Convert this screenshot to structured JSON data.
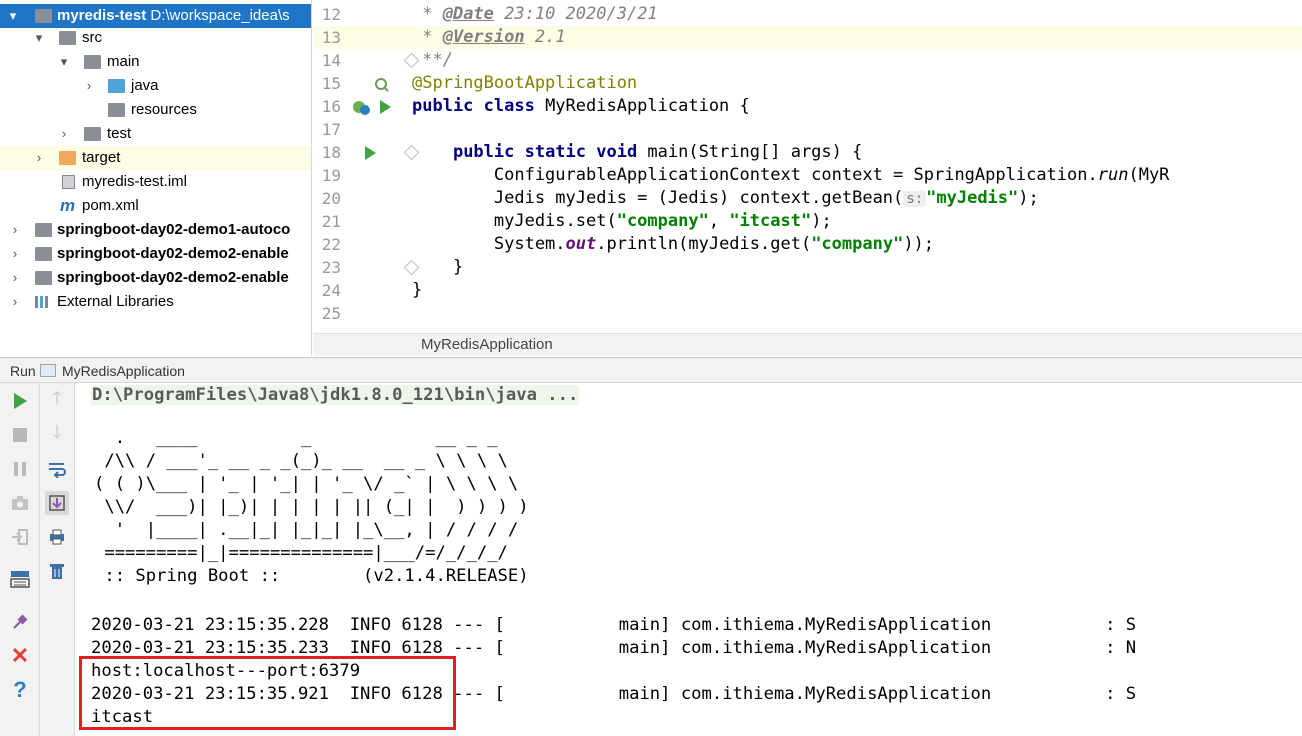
{
  "tree": {
    "root_name": "myredis-test",
    "root_path": "D:\\workspace_idea\\s",
    "items": [
      {
        "label": "src"
      },
      {
        "label": "main"
      },
      {
        "label": "java"
      },
      {
        "label": "resources"
      },
      {
        "label": "test"
      },
      {
        "label": "target"
      },
      {
        "label": "myredis-test.iml"
      },
      {
        "label": "pom.xml"
      },
      {
        "label": "springboot-day02-demo1-autoco"
      },
      {
        "label": "springboot-day02-demo2-enable"
      },
      {
        "label": "springboot-day02-demo2-enable"
      },
      {
        "label": "External Libraries"
      }
    ]
  },
  "editor": {
    "line_numbers": [
      "12",
      "13",
      "14",
      "15",
      "16",
      "17",
      "18",
      "19",
      "20",
      "21",
      "22",
      "23",
      "24",
      "25"
    ],
    "breadcrumb": "MyRedisApplication",
    "code": {
      "l12_prefix": " * ",
      "l12_tag": "@Date",
      "l12_text": " 23:10 2020/3/21",
      "l13_prefix": " * ",
      "l13_tag": "@Version",
      "l13_text": " 2.1",
      "l14": " **/",
      "l15": "@SpringBootApplication",
      "l16_kw": "public class",
      "l16_rest": " MyRedisApplication {",
      "l18_indent": "    ",
      "l18_kw": "public static void",
      "l18_rest": " main(String[] args) {",
      "l19_a": "        ConfigurableApplicationContext context = SpringApplication.",
      "l19_call": "run",
      "l19_b": "(MyR",
      "l20_a": "        Jedis myJedis = (Jedis) context.getBean(",
      "l20_hint": "s:",
      "l20_str": "\"myJedis\"",
      "l20_b": ");",
      "l21_a": "        myJedis.set(",
      "l21_s1": "\"company\"",
      "l21_mid": ", ",
      "l21_s2": "\"itcast\"",
      "l21_b": ");",
      "l22_a": "        System.",
      "l22_field": "out",
      "l22_mid": ".println(myJedis.get(",
      "l22_str": "\"company\"",
      "l22_b": "));",
      "l23": "    }",
      "l24": "}"
    }
  },
  "run_panel": {
    "label": "Run",
    "tab_title": "MyRedisApplication",
    "command": "D:\\ProgramFiles\\Java8\\jdk1.8.0_121\\bin\\java ...",
    "banner": "  .   ____          _            __ _ _\n /\\\\ / ___'_ __ _ _(_)_ __  __ _ \\ \\ \\ \\\n( ( )\\___ | '_ | '_| | '_ \\/ _` | \\ \\ \\ \\\n \\\\/  ___)| |_)| | | | | || (_| |  ) ) ) )\n  '  |____| .__|_| |_|_| |_\\__, | / / / /\n =========|_|==============|___/=/_/_/_/\n :: Spring Boot ::        (v2.1.4.RELEASE)",
    "log_lines": [
      "2020-03-21 23:15:35.228  INFO 6128 --- [           main] com.ithiema.MyRedisApplication           : S",
      "2020-03-21 23:15:35.233  INFO 6128 --- [           main] com.ithiema.MyRedisApplication           : N",
      "host:localhost---port:6379",
      "2020-03-21 23:15:35.921  INFO 6128 --- [           main] com.ithiema.MyRedisApplication           : S",
      "itcast"
    ]
  },
  "colors": {
    "selection": "#1e74c5",
    "current_line": "#fdfce4",
    "keyword": "#000080",
    "string": "#008000",
    "annotation": "#808000",
    "highlight_box": "#e02020"
  }
}
